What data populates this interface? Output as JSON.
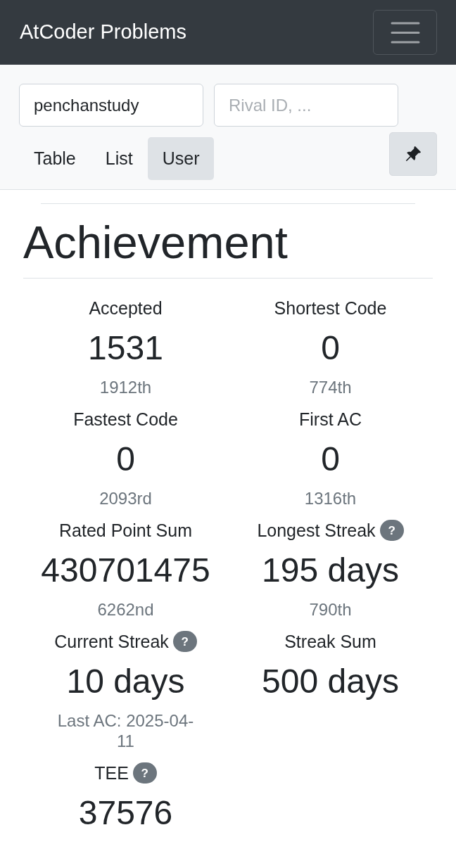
{
  "navbar": {
    "title": "AtCoder Problems"
  },
  "user_search": {
    "user_id": {
      "value": "penchanstudy"
    },
    "rival_ids": {
      "placeholder": "Rival ID, ..."
    }
  },
  "tabs": [
    {
      "label": "Table",
      "selected": false
    },
    {
      "label": "List",
      "selected": false
    },
    {
      "label": "User",
      "selected": true
    }
  ],
  "achievement": {
    "title": "Achievement",
    "stats": [
      {
        "label": "Accepted",
        "value": "1531",
        "rank": "1912th"
      },
      {
        "label": "Shortest Code",
        "value": "0",
        "rank": "774th"
      },
      {
        "label": "Fastest Code",
        "value": "0",
        "rank": "2093rd"
      },
      {
        "label": "First AC",
        "value": "0",
        "rank": "1316th"
      },
      {
        "label": "Rated Point Sum",
        "value": "430701475",
        "rank": "6262nd"
      },
      {
        "label": "Longest Streak",
        "help_badge": "?",
        "value": "195 days",
        "rank": "790th"
      },
      {
        "label": "Current Streak",
        "help_badge": "?",
        "value": "10 days",
        "rank": "Last AC: 2025-04-11"
      },
      {
        "label": "Streak Sum",
        "value": "500 days"
      },
      {
        "label": "TEE",
        "help_badge": "?",
        "value": "37576"
      }
    ]
  }
}
